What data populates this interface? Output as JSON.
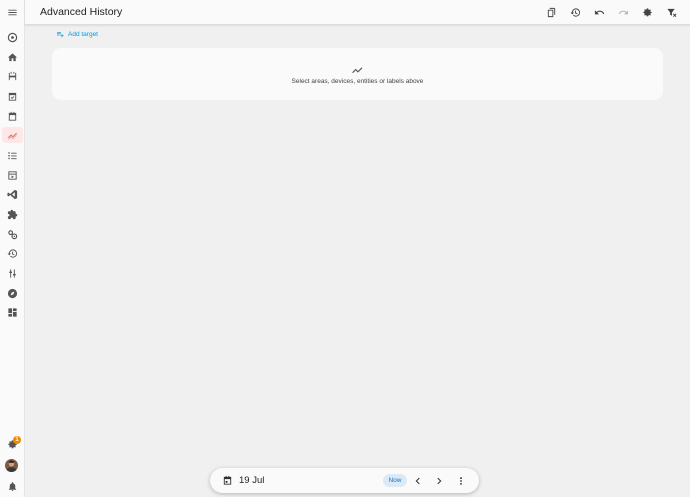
{
  "app": {
    "title": "Advanced History"
  },
  "colors": {
    "accent": "#039be5",
    "active_nav": "#e57373",
    "badge": "#ef8a00"
  },
  "sidebar": {
    "items": [
      {
        "icon": "menu-icon"
      },
      {
        "icon": "overview-icon"
      },
      {
        "icon": "home-icon"
      },
      {
        "icon": "energy-icon"
      },
      {
        "icon": "calendar-check-icon"
      },
      {
        "icon": "calendar-icon"
      },
      {
        "icon": "history-chart-icon",
        "active": true
      },
      {
        "icon": "todo-list-icon"
      },
      {
        "icon": "media-icon"
      },
      {
        "icon": "vscode-icon"
      },
      {
        "icon": "puzzle-icon"
      },
      {
        "icon": "settings-cogs-icon"
      },
      {
        "icon": "backup-history-icon"
      },
      {
        "icon": "equalizer-icon"
      },
      {
        "icon": "compass-icon"
      },
      {
        "icon": "dashboard-icon"
      }
    ],
    "bottom": {
      "settings_badge": "1",
      "notifications_icon": "bell-icon"
    }
  },
  "toolbar": {
    "buttons": [
      "copy-icon",
      "history-icon",
      "undo-icon",
      "redo-icon",
      "settings-icon",
      "filter-remove-icon"
    ]
  },
  "target": {
    "add_label": "Add target"
  },
  "empty_state": {
    "message": "Select areas, devices, entities or labels above"
  },
  "date_bar": {
    "date": "19 Jul",
    "now_label": "Now"
  }
}
